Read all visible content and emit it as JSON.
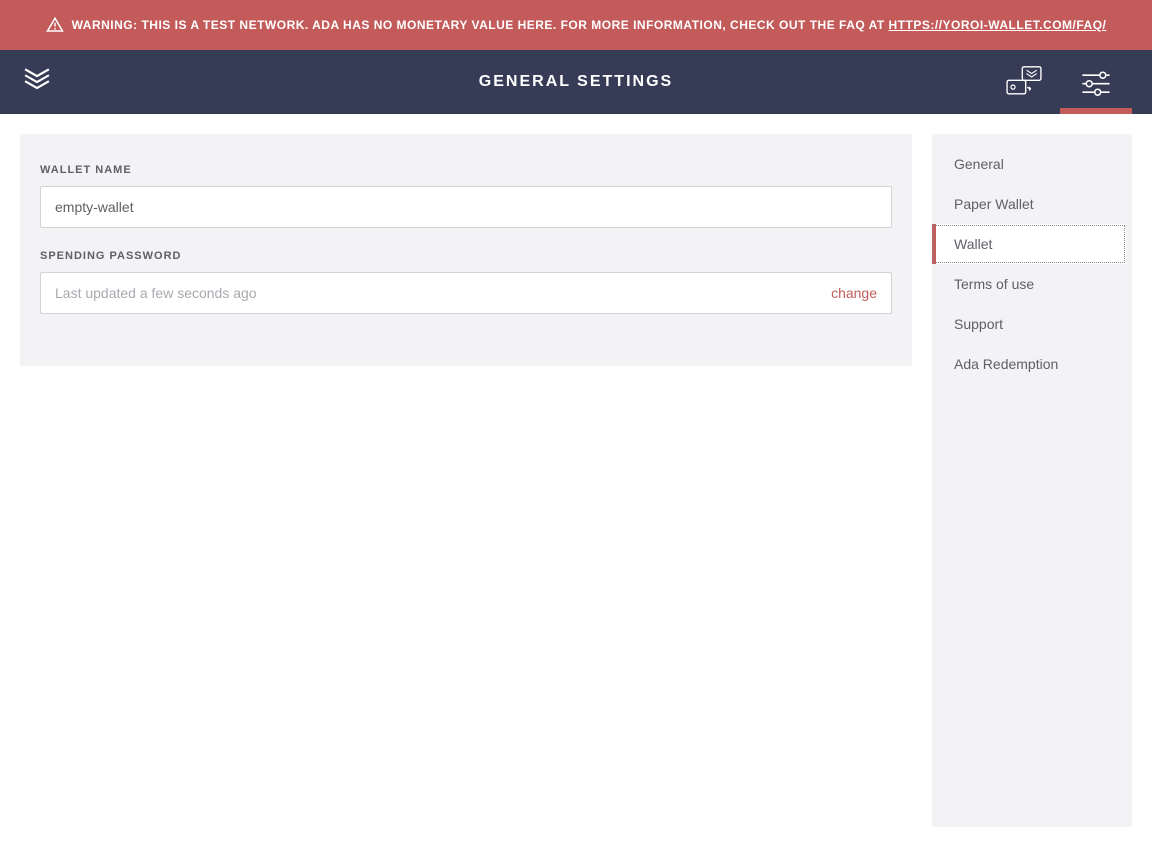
{
  "warning": {
    "prefix": "WARNING:",
    "text": " THIS IS A TEST NETWORK. ADA HAS NO MONETARY VALUE HERE. FOR MORE INFORMATION, CHECK OUT THE FAQ AT ",
    "link_text": "HTTPS://YOROI-WALLET.COM/FAQ/"
  },
  "header": {
    "title": "GENERAL SETTINGS"
  },
  "main": {
    "wallet_name_label": "WALLET NAME",
    "wallet_name_value": "empty-wallet",
    "spending_password_label": "SPENDING PASSWORD",
    "spending_password_status": "Last updated a few seconds ago",
    "change_label": "change"
  },
  "sidebar": {
    "items": [
      {
        "label": "General",
        "active": false
      },
      {
        "label": "Paper Wallet",
        "active": false
      },
      {
        "label": "Wallet",
        "active": true
      },
      {
        "label": "Terms of use",
        "active": false
      },
      {
        "label": "Support",
        "active": false
      },
      {
        "label": "Ada Redemption",
        "active": false
      }
    ]
  }
}
